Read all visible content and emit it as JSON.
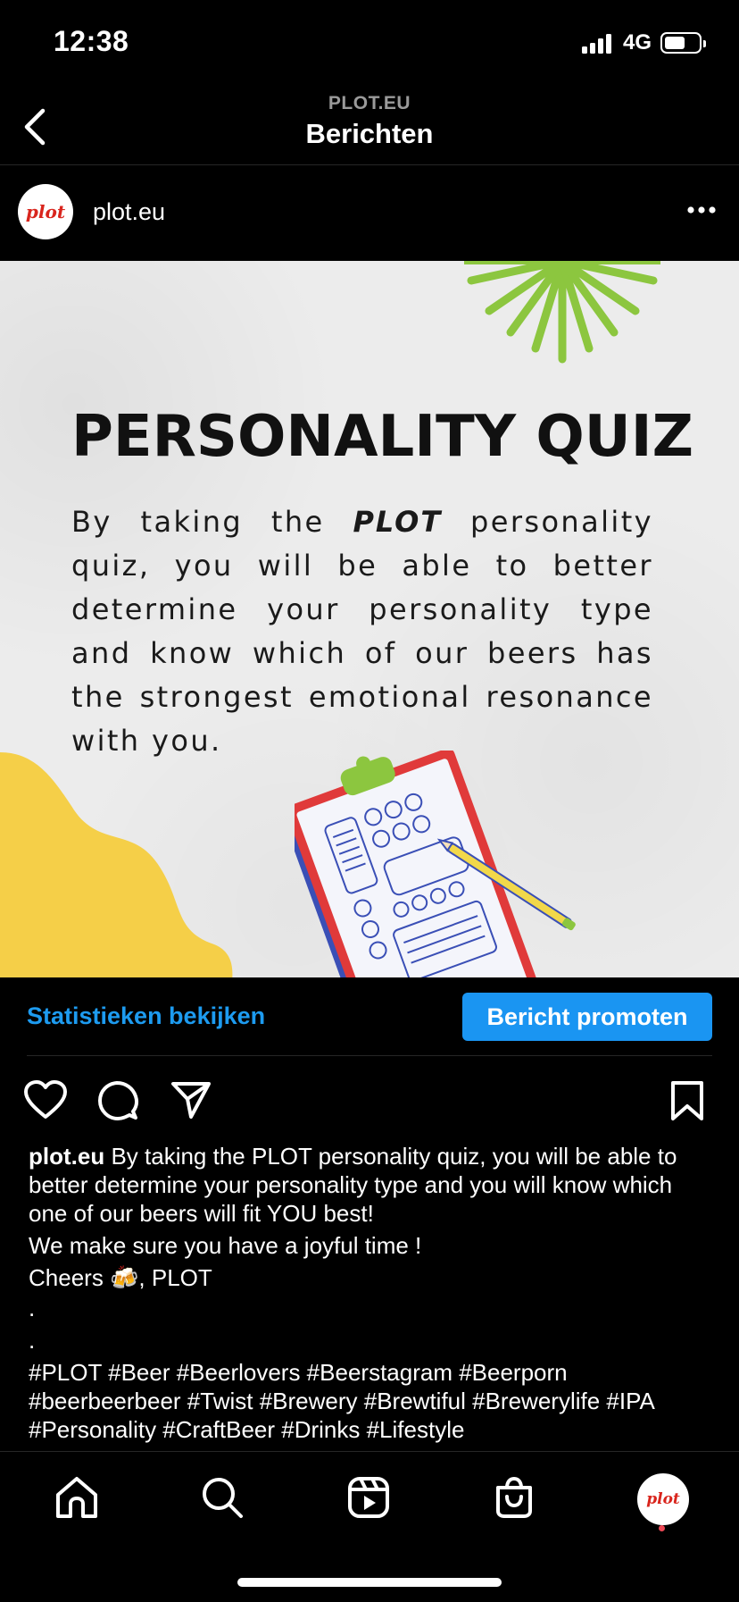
{
  "status_bar": {
    "time": "12:38",
    "network": "4G"
  },
  "header": {
    "subtitle": "PLOT.EU",
    "title": "Berichten"
  },
  "post": {
    "username": "plot.eu",
    "avatar_text": "plot",
    "image": {
      "title": "PERSONALITY QUIZ",
      "body_before": "By  taking the ",
      "body_brand": "PLOT",
      "body_after": " personality quiz, you will be able to better determine your personality type and  know which of our beers has the strongest emotional resonance with you."
    },
    "stats_link": "Statistieken bekijken",
    "promote_button": "Bericht promoten",
    "caption": {
      "username": "plot.eu",
      "text": " By taking the PLOT personality quiz, you will be able to better determine your personality type and you will know which one of our beers will fit YOU best!",
      "line2": "We make sure you have a joyful time !",
      "line3": "Cheers 🍻, PLOT",
      "dot1": ".",
      "dot2": ".",
      "hashtags": " #PLOT #Beer #Beerlovers #Beerstagram #Beerporn #beerbeerbeer #Twist #Brewery #Brewtiful #Brewerylife #IPA #Personality #CraftBeer #Drinks #Lifestyle"
    }
  },
  "colors": {
    "accent": "#1a95f2",
    "logo_red": "#d9251d",
    "sunburst": "#8cc63f",
    "blob": "#f5cf48"
  },
  "icons": [
    "chevron-left-icon",
    "more-icon",
    "heart-icon",
    "comment-icon",
    "send-icon",
    "bookmark-icon",
    "home-icon",
    "search-icon",
    "reels-icon",
    "shop-icon"
  ]
}
